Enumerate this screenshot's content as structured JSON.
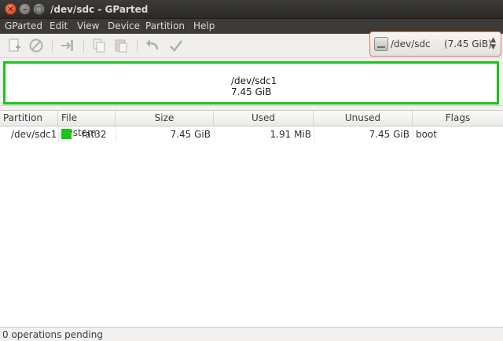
{
  "window": {
    "title": "/dev/sdc - GParted"
  },
  "menubar": {
    "items": [
      "GParted",
      "Edit",
      "View",
      "Device",
      "Partition",
      "Help"
    ]
  },
  "device_selector": {
    "device": "/dev/sdc",
    "size": "(7.45 GiB)"
  },
  "disk_map": {
    "partition_name": "/dev/sdc1",
    "partition_size": "7.45 GiB",
    "color": "#18c618"
  },
  "table": {
    "columns": [
      "Partition",
      "File System",
      "Size",
      "Used",
      "Unused",
      "Flags"
    ],
    "rows": [
      {
        "partition": "/dev/sdc1",
        "filesystem": "fat32",
        "fs_color": "#18c618",
        "size": "7.45 GiB",
        "used": "1.91 MiB",
        "unused": "7.45 GiB",
        "flags": "boot"
      }
    ]
  },
  "statusbar": {
    "text": "0 operations pending"
  }
}
